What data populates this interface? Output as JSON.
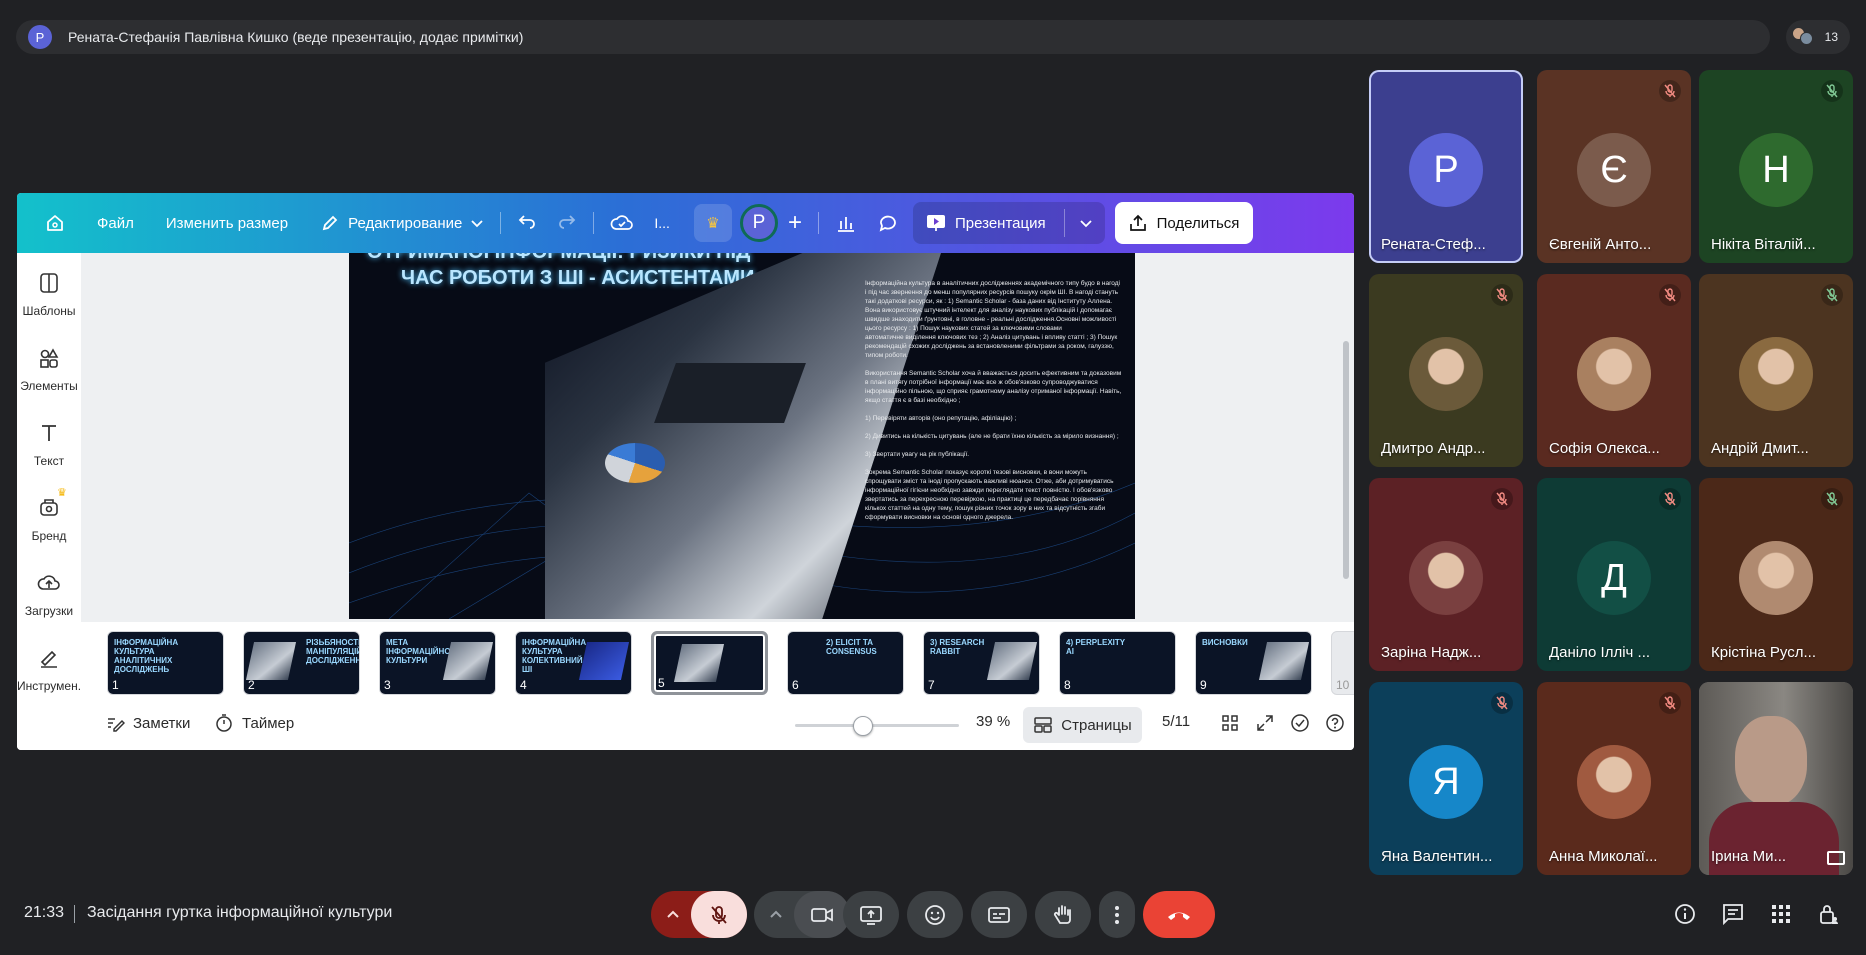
{
  "header": {
    "presenter_initial": "Р",
    "title": "Рената-Стефанія Павлівна Кишко (веде презентацію, додає примітки)",
    "participant_count": "13"
  },
  "canva": {
    "toolbar": {
      "file": "Файл",
      "resize": "Изменить размер",
      "edit": "Редактирование",
      "truncated": "I...",
      "avatar": "P",
      "present": "Презентация",
      "share": "Поделиться"
    },
    "sidebar": [
      {
        "label": "Шаблоны",
        "icon": "templates-icon"
      },
      {
        "label": "Элементы",
        "icon": "elements-icon"
      },
      {
        "label": "Текст",
        "icon": "text-icon"
      },
      {
        "label": "Бренд",
        "icon": "brand-icon"
      },
      {
        "label": "Загрузки",
        "icon": "uploads-icon"
      },
      {
        "label": "Инструмен...",
        "icon": "tools-icon"
      }
    ],
    "slide": {
      "heading_line1": "ОТРИМАНОЇ ІНФОРМАЦІЇ: РИЗИКИ ПІД",
      "heading_line2": "ЧАС РОБОТИ З ШІ - АСИСТЕНТАМИ",
      "paragraphs": [
        "Інформаційна культура в аналітичних дослідженнях академічного типу будо в нагоді і під час звернення до менш популярних ресурсів пошуку окрім ШІ. В нагоді стануть такі додаткові ресурси, як : 1) Semantic Scholar - база даних від Інституту Аллена. Вона використовує штучний інтелект для аналізу наукових публікацій і допомагає швидше знаходити ґрунтовні, в головне - реальні дослідження.Основні можливості цього ресурсу : 1) Пошук наукових статей за ключовими словами",
        "автоматичне виділення ключових тез ; 2) Аналіз цитувань і впливу статті ; 3) Пошук рекомендацій схожих досліджень за встановленими фільтрами за роком, галуззю, типом роботи.",
        "Використання Semantic Scholar хоча й вважається досить ефективним та доказовим в плані витягу потрібної інформації має все ж обов'язково супроводжуватися інформаційно пільною, що сприяє грамотному аналізу отриманої інформації. Навіть, якщо стаття є в базі необхідно ;",
        "1) Перевіряти авторів (оно репутацію, афіліацію) ;",
        "2) Дивитись на кількість цитувань (але не брати їхню кількість за мірило визнання) ;",
        "3) Звертати увагу на рік публікації.",
        "Зокрема Semantic Scholar показує короткі тезові висновки, в вони можуть спрощувати зміст та іноді пропускають важливі нюанси. Отже, аби дотримуватись інформаційної гігієни необхідно завжди переглядати текст повністю. І обов'язково звертатись за перехресною перевіркою, на практиці це передбачає порівняння кількох статтей на одну тему, пошук різних точок зору в них та відсутність згаби сформувати висновки на основі одного джерела."
      ]
    },
    "thumbnails": [
      {
        "n": "1",
        "title": "ІНФОРМАЦІЙНА КУЛЬТУРА АНАЛІТИЧНИХ ДОСЛІДЖЕНЬ"
      },
      {
        "n": "2",
        "title": "РІЗЬБЯНОСТІ МАНІПУЛЯЦІЙ ДОСЛІДЖЕННЯ"
      },
      {
        "n": "3",
        "title": "МЕТА ІНФОРМАЦІЙНОЇ КУЛЬТУРИ"
      },
      {
        "n": "4",
        "title": "ІНФОРМАЦІЙНА КУЛЬТУРА КОЛЕКТИВНИЙ ШІ"
      },
      {
        "n": "5",
        "title": ""
      },
      {
        "n": "6",
        "title": "2) ELICIT ТА CONSENSUS"
      },
      {
        "n": "7",
        "title": "3) RESEARCH RABBIT"
      },
      {
        "n": "8",
        "title": "4) PERPLEXITY AI"
      },
      {
        "n": "9",
        "title": "ВИСНОВКИ"
      },
      {
        "n": "10",
        "title": ""
      }
    ],
    "bottom": {
      "notes": "Заметки",
      "timer": "Таймер",
      "zoom": "39 %",
      "zoom_fraction": 0.39,
      "pages": "Страницы",
      "page_indicator": "5/11"
    }
  },
  "tiles": [
    {
      "name": "Рената-Стеф...",
      "initial": "Р",
      "bg": "#3c3f8f",
      "avatar_bg": "#5b63d6",
      "muted": false,
      "selected": true
    },
    {
      "name": "Євгеній Анто...",
      "initial": "Є",
      "bg": "#5a3324",
      "avatar_bg": "#7b5b4c",
      "muted": true
    },
    {
      "name": "Нікіта Віталій...",
      "initial": "Н",
      "bg": "#1d4423",
      "avatar_bg": "#2e6a2e",
      "muted": true
    },
    {
      "name": "Дмитро Андр...",
      "initial": "",
      "bg": "#3b3a20",
      "avatar_bg": "#6b5a3a",
      "muted": true
    },
    {
      "name": "Софія Олекса...",
      "initial": "",
      "bg": "#5a2a20",
      "avatar_bg": "#a98060",
      "muted": true
    },
    {
      "name": "Андрій Дмит...",
      "initial": "",
      "bg": "#4c3420",
      "avatar_bg": "#8a6a40",
      "muted": true
    },
    {
      "name": "Заріна Надж...",
      "initial": "",
      "bg": "#5c2125",
      "avatar_bg": "#7a4040",
      "muted": true
    },
    {
      "name": "Даніло Ілліч ...",
      "initial": "Д",
      "bg": "#0e3b35",
      "avatar_bg": "#124f45",
      "muted": true
    },
    {
      "name": "Крістіна Русл...",
      "initial": "",
      "bg": "#4b2818",
      "avatar_bg": "#b08a70",
      "muted": true
    },
    {
      "name": "Яна Валентин...",
      "initial": "Я",
      "bg": "#0c3f5a",
      "avatar_bg": "#1687c9",
      "muted": true
    },
    {
      "name": "Анна Миколаї...",
      "initial": "",
      "bg": "#5a2a1c",
      "avatar_bg": "#a05a40",
      "muted": true
    },
    {
      "name": "Ірина Ми...",
      "initial": "",
      "bg": "#6f6c6a",
      "avatar_bg": "#8b7b70",
      "muted": false
    }
  ],
  "footer": {
    "time": "21:33",
    "meeting": "Засідання гуртка інформаційної культури"
  },
  "colors": {
    "end_call": "#ea4335",
    "mic_off_bg": "#f9dedc",
    "mic_arrow_bg": "#8c1d18"
  }
}
